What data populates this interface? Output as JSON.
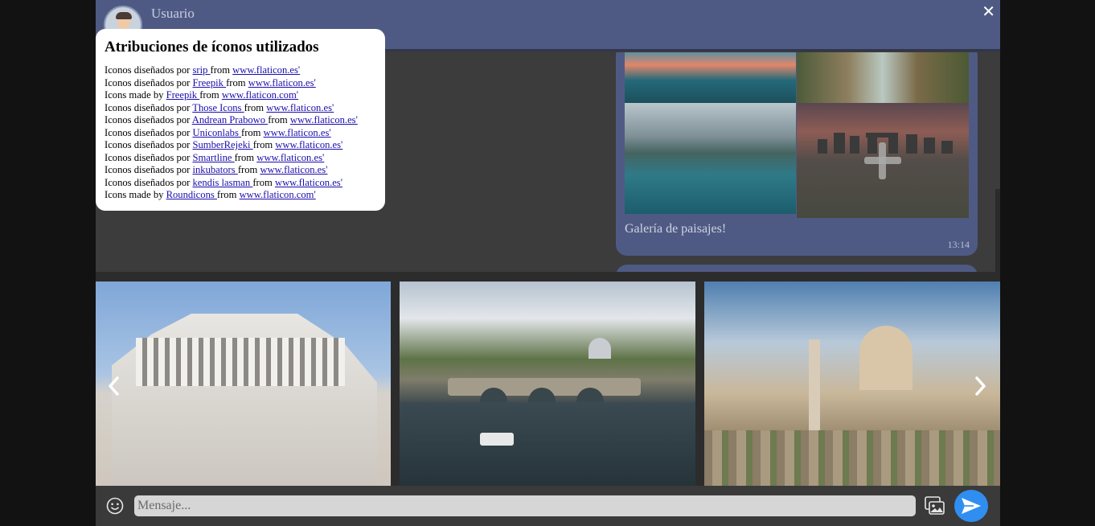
{
  "header": {
    "username": "Usuario",
    "close_label": "✕"
  },
  "attributions": {
    "title": "Atribuciones de íconos utilizados",
    "lines": [
      {
        "prefix": "Iconos diseñados por ",
        "author": "srip ",
        "mid": "from ",
        "site": "www.flaticon.es'"
      },
      {
        "prefix": "Iconos diseñados por ",
        "author": "Freepik ",
        "mid": "from ",
        "site": "www.flaticon.es'"
      },
      {
        "prefix": "Icons made by ",
        "author": "Freepik ",
        "mid": "from ",
        "site": "www.flaticon.com'"
      },
      {
        "prefix": "Iconos diseñados por ",
        "author": "Those Icons ",
        "mid": "from ",
        "site": "www.flaticon.es'"
      },
      {
        "prefix": "Iconos diseñados por ",
        "author": "Andrean Prabowo ",
        "mid": "from ",
        "site": "www.flaticon.es'"
      },
      {
        "prefix": "Iconos diseñados por ",
        "author": "Uniconlabs ",
        "mid": "from ",
        "site": "www.flaticon.es'"
      },
      {
        "prefix": "Iconos diseñados por ",
        "author": "SumberRejeki ",
        "mid": "from ",
        "site": "www.flaticon.es'"
      },
      {
        "prefix": "Iconos diseñados por ",
        "author": "Smartline ",
        "mid": "from ",
        "site": "www.flaticon.es'"
      },
      {
        "prefix": "Iconos diseñados por ",
        "author": "inkubators ",
        "mid": "from ",
        "site": "www.flaticon.es'"
      },
      {
        "prefix": "Iconos diseñados por ",
        "author": "kendis lasman ",
        "mid": "from ",
        "site": "www.flaticon.es'"
      },
      {
        "prefix": "Icons made by ",
        "author": "Roundicons ",
        "mid": "from ",
        "site": "www.flaticon.com'"
      }
    ]
  },
  "message": {
    "caption": "Galería de paisajes!",
    "time": "13:14"
  },
  "composer": {
    "placeholder": "Mensaje..."
  },
  "colors": {
    "header": "#4f5a84",
    "bubble": "#4f5a84",
    "send_button": "#2f8ef0",
    "background": "#121212"
  },
  "icons": {
    "emoji": "smiley-icon",
    "gallery": "gallery-icon",
    "send": "send-icon",
    "prev": "chevron-left-icon",
    "next": "chevron-right-icon",
    "close": "close-icon",
    "more": "plus-icon"
  }
}
